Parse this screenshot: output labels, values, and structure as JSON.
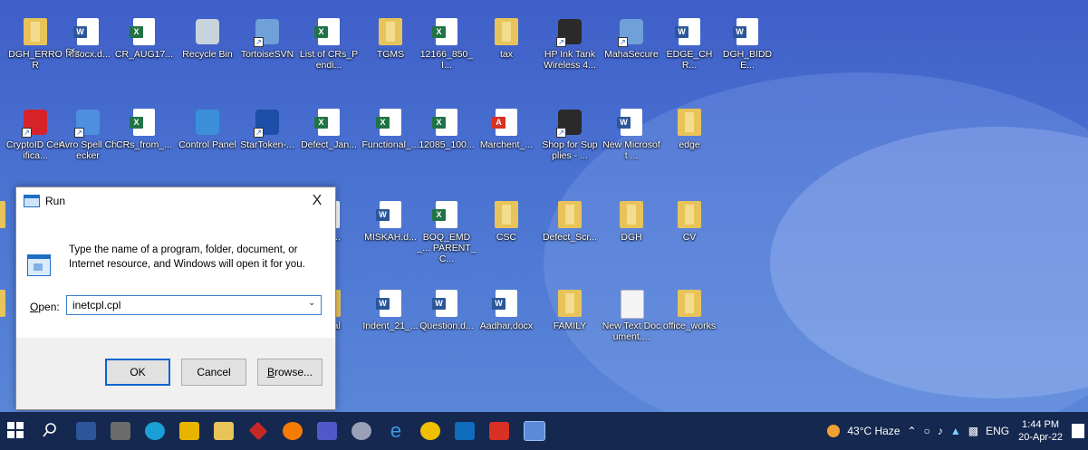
{
  "desktop_icons": [
    {
      "label": "DGH_ERROR",
      "kind": "folder"
    },
    {
      "label": "र्शिडocx.d...",
      "kind": "word"
    },
    {
      "label": "CR_AUG17...",
      "kind": "excel"
    },
    {
      "label": "Recycle Bin",
      "kind": "recycle"
    },
    {
      "label": "TortoiseSVN",
      "kind": "app"
    },
    {
      "label": "List of CRs_Pendi...",
      "kind": "excel"
    },
    {
      "label": "TGMS",
      "kind": "folder"
    },
    {
      "label": "12166_850_I...",
      "kind": "excel"
    },
    {
      "label": "tax",
      "kind": "folder"
    },
    {
      "label": "HP Ink Tank Wireless 4...",
      "kind": "printer"
    },
    {
      "label": "MahaSecure",
      "kind": "app"
    },
    {
      "label": "EDGE_CHR...",
      "kind": "word"
    },
    {
      "label": "DGH_BIDDE...",
      "kind": "word"
    },
    {
      "label": "CryptoID Certifica...",
      "kind": "crypto"
    },
    {
      "label": "Avro Spell Checker",
      "kind": "avro"
    },
    {
      "label": "CRs_from_...",
      "kind": "excel"
    },
    {
      "label": "Control Panel",
      "kind": "control"
    },
    {
      "label": "StarToken-...",
      "kind": "star"
    },
    {
      "label": "Defect_Jan...",
      "kind": "excel"
    },
    {
      "label": "Functional_...",
      "kind": "excel"
    },
    {
      "label": "12085_100...",
      "kind": "excel"
    },
    {
      "label": "Marchent_...",
      "kind": "pdf"
    },
    {
      "label": "Shop for Supplies - ...",
      "kind": "printer"
    },
    {
      "label": "New Microsoft ...",
      "kind": "word"
    },
    {
      "label": "edge",
      "kind": "folder"
    },
    {
      "label": "pl",
      "kind": "folder"
    },
    {
      "label": "atio...",
      "kind": "excel"
    },
    {
      "label": "MISKAH.d...",
      "kind": "word"
    },
    {
      "label": "BOQ_EMD_... PARENT_C...",
      "kind": "excel"
    },
    {
      "label": "CSC",
      "kind": "folder"
    },
    {
      "label": "Defect_Scr...",
      "kind": "folder"
    },
    {
      "label": "DGH",
      "kind": "folder"
    },
    {
      "label": "CV",
      "kind": "folder"
    },
    {
      "label": "l",
      "kind": "folder"
    },
    {
      "label": "anual",
      "kind": "folder"
    },
    {
      "label": "Indent_21_...",
      "kind": "word"
    },
    {
      "label": "Question.d...",
      "kind": "word"
    },
    {
      "label": "Aadhar.docx",
      "kind": "word"
    },
    {
      "label": "FAMILY",
      "kind": "folder"
    },
    {
      "label": "New Text Document....",
      "kind": "text"
    },
    {
      "label": "office_works",
      "kind": "folder"
    }
  ],
  "run_dialog": {
    "title": "Run",
    "close": "X",
    "description": "Type the name of a program, folder, document, or Internet resource, and Windows will open it for you.",
    "open_label": "Open:",
    "open_value": "inetcpl.cpl",
    "ok": "OK",
    "cancel": "Cancel",
    "browse": "Browse..."
  },
  "taskbar": {
    "weather": "43°C Haze",
    "language": "ENG",
    "time": "1:44 PM",
    "date": "20-Apr-22"
  },
  "colors": {
    "word": "#2b579a",
    "excel": "#217346",
    "pdf": "#d93025",
    "folder": "#e8c35a",
    "accent": "#0a64cf"
  }
}
